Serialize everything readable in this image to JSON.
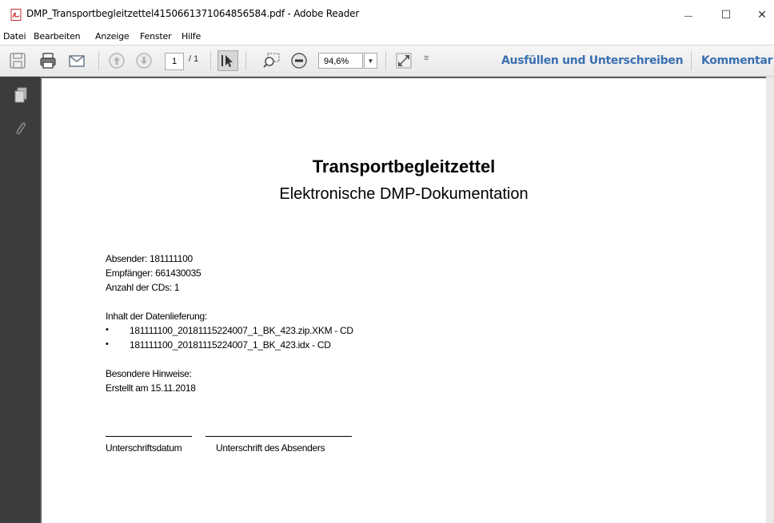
{
  "window": {
    "title": "DMP_Transportbegleitzettel4150661371064856584.pdf - Adobe Reader",
    "minimize_glyph": "—",
    "maximize_glyph": "☐",
    "close_glyph": "✕"
  },
  "menu": [
    "Datei",
    "Bearbeiten",
    "Anzeige",
    "Fenster",
    "Hilfe"
  ],
  "toolbar": {
    "page_current": "1",
    "page_total": "/ 1",
    "zoom": "94,6%",
    "zoom_dropdown_glyph": "▼",
    "overflow_glyph": "≡",
    "fill_sign_label": "Ausfüllen und Unterschreiben",
    "comment_label": "Kommentar"
  },
  "document": {
    "title": "Transportbegleitzettel",
    "subtitle": "Elektronische DMP-Dokumentation",
    "sender": "Absender: 181111100",
    "recipient": "Empfänger: 661430035",
    "cd_count": "Anzahl der CDs: 1",
    "contents_heading": "Inhalt der Datenlieferung:",
    "contents_items": [
      "181111100_20181115224007_1_BK_423.zip.XKM - CD",
      "181111100_20181115224007_1_BK_423.idx - CD"
    ],
    "bullet_glyph": "•",
    "notes_heading": "Besondere Hinweise:",
    "created": "Erstellt am 15.11.2018",
    "signature_date_label": "Unterschriftsdatum",
    "signature_sender_label": "Unterschrift des Absenders"
  },
  "colors": {
    "link_blue": "#3b6fb1",
    "nav_dark": "#3c3c3c",
    "doc_bg": "#5a5a5a",
    "pdf_red": "#c0302a"
  }
}
